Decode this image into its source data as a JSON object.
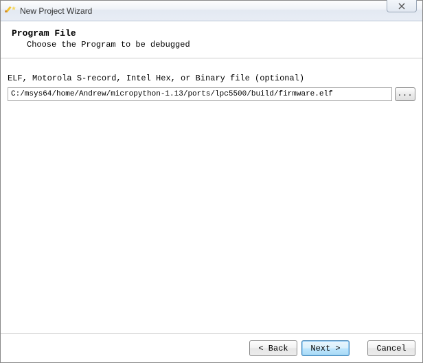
{
  "titlebar": {
    "title": "New Project Wizard",
    "close_label": "✕"
  },
  "header": {
    "title": "Program File",
    "subtitle": "Choose the Program to be debugged"
  },
  "form": {
    "file_label": "ELF, Motorola S-record, Intel Hex, or Binary file (optional)",
    "file_path": "C:/msys64/home/Andrew/micropython-1.13/ports/lpc5500/build/firmware.elf",
    "browse_label": "..."
  },
  "footer": {
    "back_label": "< Back",
    "next_label": "Next >",
    "cancel_label": "Cancel"
  }
}
